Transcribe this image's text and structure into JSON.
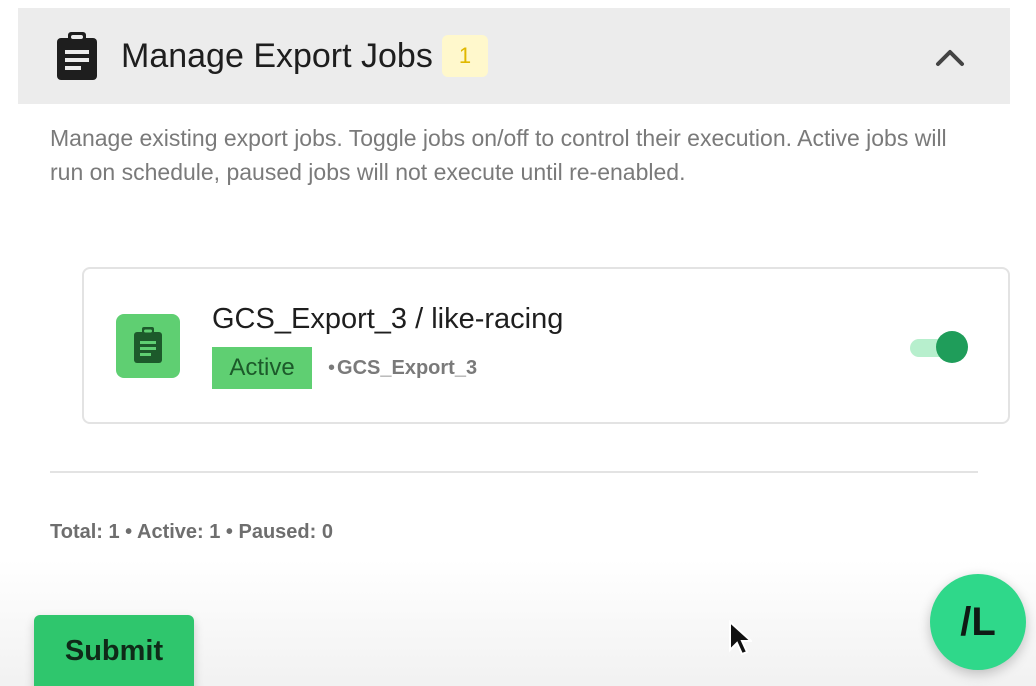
{
  "section": {
    "title": "Manage Export Jobs",
    "count_badge": "1",
    "description": "Manage existing export jobs. Toggle jobs on/off to control their execution. Active jobs will run on schedule, paused jobs will not execute until re-enabled.",
    "collapse_icon": "chevron-up-icon",
    "header_icon": "clipboard-icon"
  },
  "jobs": [
    {
      "title": "GCS_Export_3 / like-racing",
      "status": "Active",
      "subtitle": "GCS_Export_3",
      "separator": "•",
      "enabled": true,
      "icon": "clipboard-icon"
    }
  ],
  "summary": "Total: 1 • Active: 1 • Paused: 0",
  "submit_label": "Submit",
  "fab_label": "/L",
  "colors": {
    "header_bg": "#ececec",
    "active_green": "#5fcf72",
    "toggle_knob": "#1f9d5a",
    "submit_green": "#2fc66d",
    "fab_green": "#2fd88a",
    "badge_bg": "#fff8cc",
    "badge_text": "#e0b800"
  }
}
